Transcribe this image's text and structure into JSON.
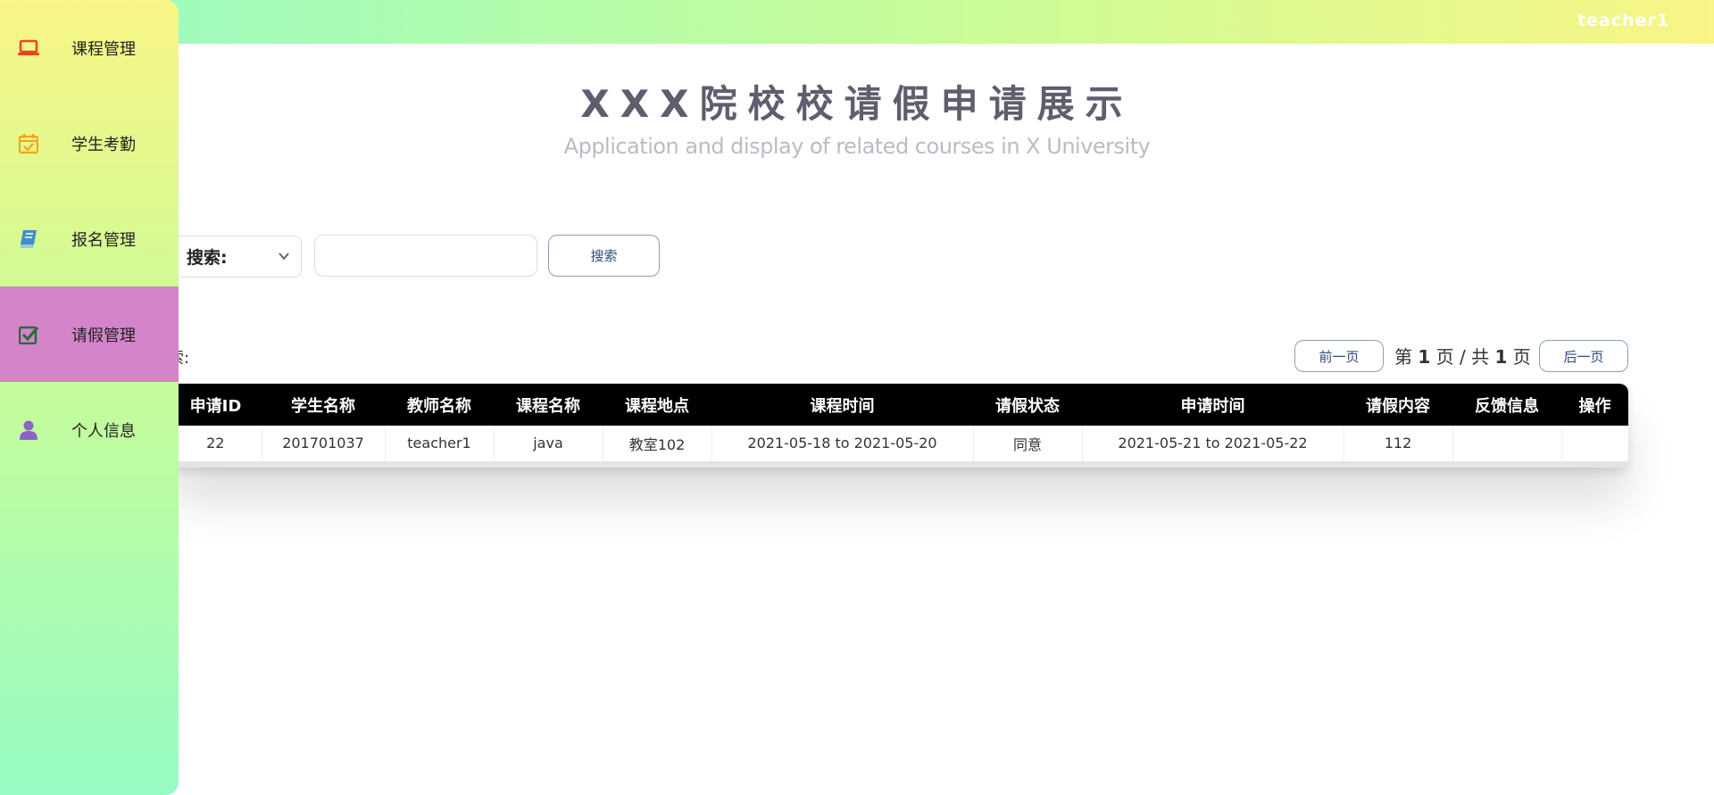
{
  "header": {
    "user": "teacher1",
    "gradient": [
      "#96fbc4",
      "#f9f586"
    ]
  },
  "sidebar": {
    "active_color": "#d484c9",
    "items": [
      {
        "label": "课程管理",
        "icon": "laptop-icon",
        "icon_color": "#e8441f"
      },
      {
        "label": "学生考勤",
        "icon": "calendar-check-icon",
        "icon_color": "#f3a518"
      },
      {
        "label": "报名管理",
        "icon": "book-icon",
        "icon_color": "#3f8fc8"
      },
      {
        "label": "请假管理",
        "icon": "check-square-icon",
        "icon_color": "#1d6f36",
        "active": true
      },
      {
        "label": "个人信息",
        "icon": "user-icon",
        "icon_color": "#8b63c8"
      }
    ]
  },
  "page": {
    "title": "XXX院校校请假申请展示",
    "subtitle": "Application and display of related courses in X University"
  },
  "search": {
    "select_label": "搜索:",
    "input_value": "",
    "input_placeholder": "",
    "button_label": "搜索",
    "echo_label": "搜索:"
  },
  "pager": {
    "prev_label": "前一页",
    "next_label": "后一页",
    "text_prefix": "第 ",
    "current": "1",
    "text_mid": " 页 / 共 ",
    "total": "1",
    "text_suffix": " 页"
  },
  "table": {
    "headers": [
      "申请ID",
      "学生名称",
      "教师名称",
      "课程名称",
      "课程地点",
      "课程时间",
      "请假状态",
      "申请时间",
      "请假内容",
      "反馈信息",
      "操作"
    ],
    "rows": [
      [
        "22",
        "201701037",
        "teacher1",
        "java",
        "教室102",
        "2021-05-18 to 2021-05-20",
        "同意",
        "2021-05-21 to 2021-05-22",
        "112",
        "",
        ""
      ]
    ]
  }
}
